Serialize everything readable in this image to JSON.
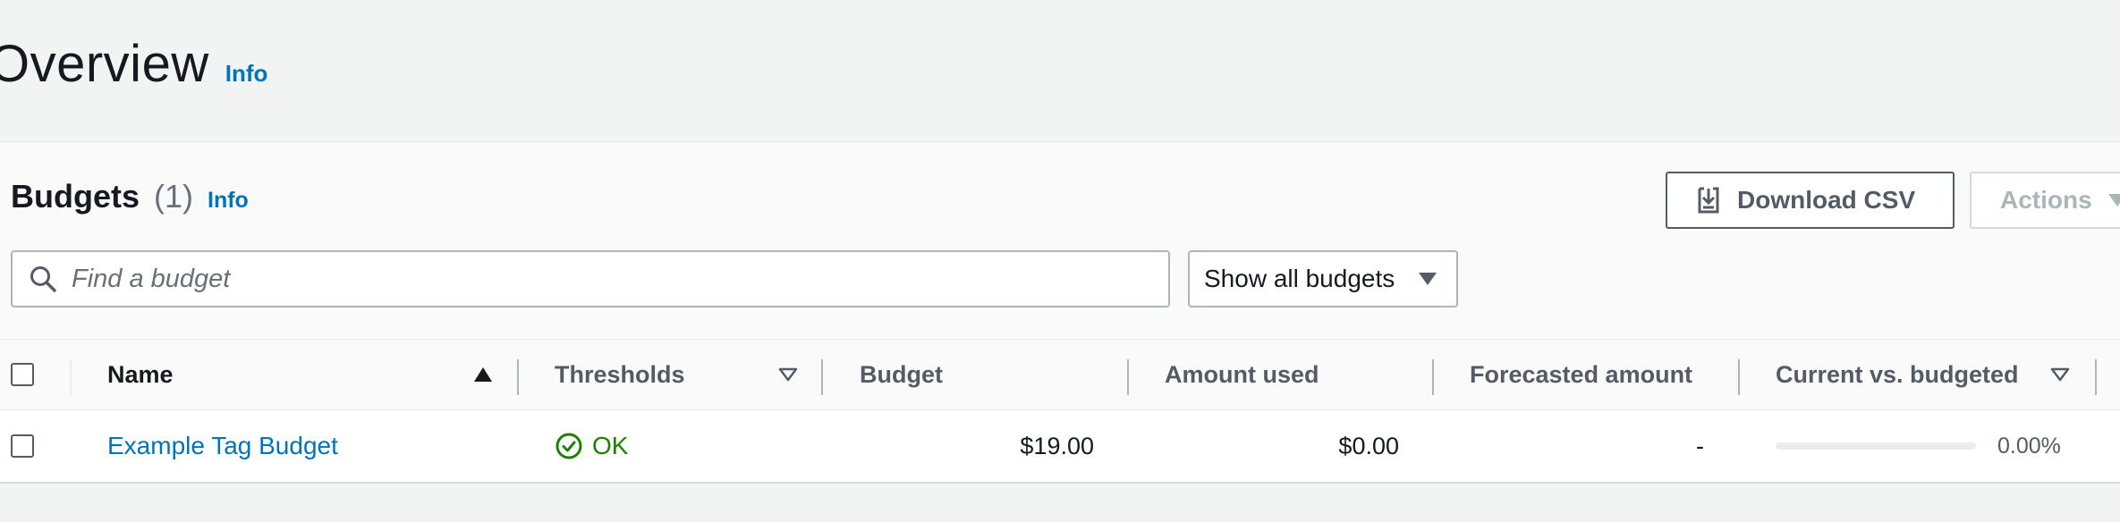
{
  "page": {
    "title": "Overview",
    "info_label": "Info"
  },
  "budgets": {
    "title": "Budgets",
    "count": "(1)",
    "info_label": "Info",
    "download_label": "Download CSV",
    "actions_label": "Actions",
    "search_placeholder": "Find a budget",
    "filter_selected": "Show all budgets",
    "columns": {
      "name": "Name",
      "thresholds": "Thresholds",
      "budget": "Budget",
      "amount_used": "Amount used",
      "forecasted": "Forecasted amount",
      "current_vs_budgeted": "Current vs. budgeted"
    },
    "rows": [
      {
        "name": "Example Tag Budget",
        "threshold_status": "OK",
        "budget": "$19.00",
        "amount_used": "$0.00",
        "forecasted": "-",
        "current_vs_budgeted_pct": "0.00%",
        "progress_fraction": 0.0
      }
    ]
  },
  "colors": {
    "link": "#0073bb",
    "ok_green": "#1d8102",
    "text": "#16191f",
    "muted": "#545b64"
  },
  "icons": [
    "download-icon",
    "search-icon",
    "caret-down-icon",
    "sort-ascending-icon",
    "sort-descending-outline-icon",
    "check-circle-icon"
  ]
}
